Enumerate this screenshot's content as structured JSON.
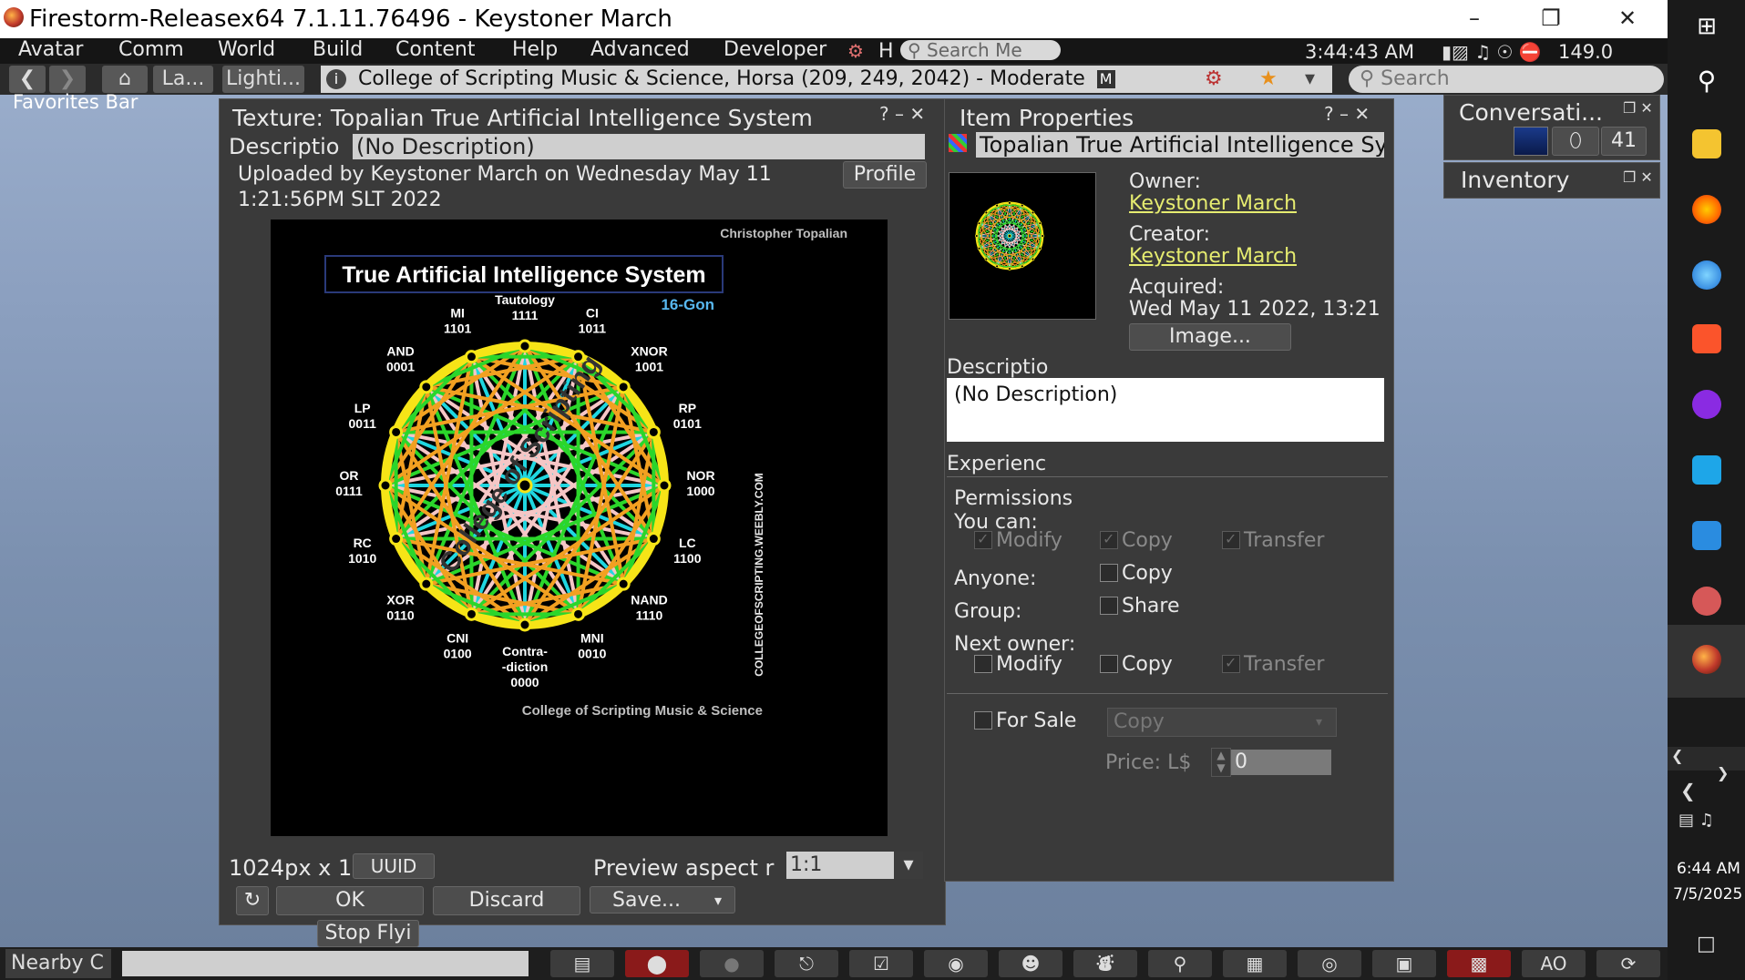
{
  "window": {
    "title": "Firestorm-Releasex64 7.1.11.76496 - Keystoner March"
  },
  "menu": [
    "Avatar",
    "Comm",
    "World",
    "Build",
    "Content",
    "Help",
    "Advanced",
    "Developer"
  ],
  "menubar": {
    "search_placeholder": "Search Me",
    "clock": "3:44:43 AM",
    "fps": "149.0",
    "h_label": "H"
  },
  "nav": {
    "tab_landmarks": "La...",
    "tab_lighting": "Lighti...",
    "location": "College of Scripting Music & Science, Horsa (209, 249, 2042) - Moderate",
    "maturity_badge": "M",
    "search_placeholder": "Search",
    "favorites": "Favorites Bar"
  },
  "texture_window": {
    "title": "Texture: Topalian True Artificial Intelligence System",
    "desc_label": "Descriptio",
    "desc_value": "(No Description)",
    "uploaded_line1": "Uploaded by Keystoner March on Wednesday May 11",
    "uploaded_line2": "1:21:56PM SLT 2022",
    "profile_btn": "Profile",
    "dimensions": "1024px x 1",
    "uuid_btn": "UUID",
    "preview_aspect_label": "Preview aspect r",
    "preview_aspect_value": "1:1",
    "ok_btn": "OK",
    "discard_btn": "Discard",
    "save_btn": "Save..."
  },
  "texture_image": {
    "author": "Christopher Topalian",
    "heading": "True Artificial Intelligence System",
    "gon": "16-Gon",
    "footer": "College of Scripting Music & Science",
    "side_text": "COLLEGEOFSCRIPTING.WEEBLY.COM",
    "watermark": "College of Scripting",
    "nodes": [
      {
        "name": "Tautology",
        "code": "1111"
      },
      {
        "name": "CI",
        "code": "1011"
      },
      {
        "name": "XNOR",
        "code": "1001"
      },
      {
        "name": "RP",
        "code": "0101"
      },
      {
        "name": "NOR",
        "code": "1000"
      },
      {
        "name": "LC",
        "code": "1100"
      },
      {
        "name": "NAND",
        "code": "1110"
      },
      {
        "name": "MNI",
        "code": "0010"
      },
      {
        "name": "Contra-\n-diction",
        "code": "0000"
      },
      {
        "name": "CNI",
        "code": "0100"
      },
      {
        "name": "XOR",
        "code": "0110"
      },
      {
        "name": "RC",
        "code": "1010"
      },
      {
        "name": "OR",
        "code": "0111"
      },
      {
        "name": "LP",
        "code": "0011"
      },
      {
        "name": "AND",
        "code": "0001"
      },
      {
        "name": "MI",
        "code": "1101"
      }
    ]
  },
  "item_properties": {
    "title": "Item Properties",
    "name": "Topalian True Artificial Intelligence Syst",
    "owner_label": "Owner:",
    "owner": "Keystoner March",
    "creator_label": "Creator:",
    "creator": "Keystoner March",
    "acquired_label": "Acquired:",
    "acquired": "Wed May 11 2022, 13:21",
    "image_btn": "Image...",
    "desc_label": "Descriptio",
    "desc_value": "(No Description)",
    "experience_label": "Experienc",
    "permissions_label": "Permissions",
    "you_can_label": "You can:",
    "modify": "Modify",
    "copy": "Copy",
    "transfer": "Transfer",
    "anyone_label": "Anyone:",
    "group_label": "Group:",
    "share": "Share",
    "next_owner_label": "Next owner:",
    "for_sale": "For Sale",
    "sale_type": "Copy",
    "price_label": "Price: L$",
    "price_value": "0"
  },
  "side_panels": {
    "conversations": "Conversati...",
    "conv_count": "41",
    "inventory": "Inventory"
  },
  "stop_flying": "Stop Flyi",
  "bottom": {
    "nearby_chat": "Nearby C",
    "ao": "AO"
  },
  "win_clock": {
    "time": "6:44 AM",
    "date": "7/5/2025"
  }
}
